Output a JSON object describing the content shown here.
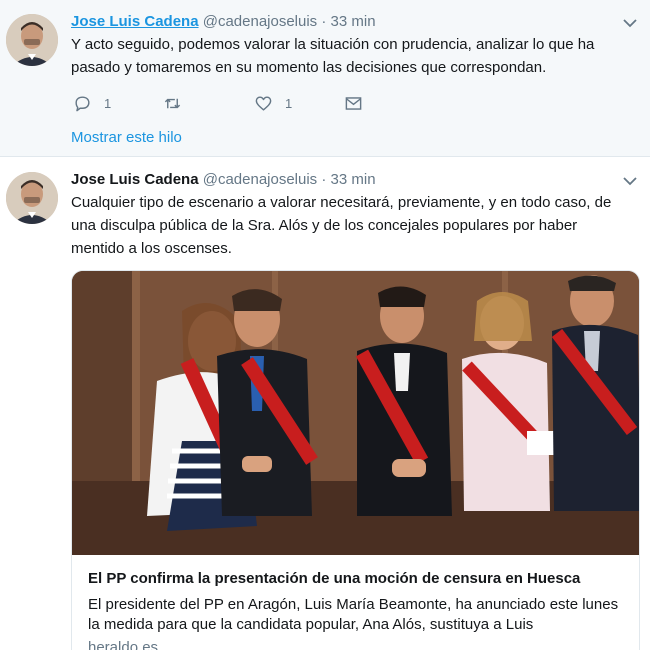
{
  "colors": {
    "link": "#1b95e0",
    "secondary": "#657786",
    "thread_bg": "#f5f8fa"
  },
  "tweets": [
    {
      "name": "Jose Luis Cadena",
      "handle": "@cadenajoseluis",
      "dot": "·",
      "time": "33 min",
      "text": "Y acto seguido,  podemos valorar la situación con prudencia, analizar lo que ha\npasado y tomaremos en su momento las decisiones que correspondan.",
      "actions": {
        "reply_count": "1",
        "retweet_count": "",
        "like_count": "1"
      },
      "show_thread": "Mostrar este hilo"
    },
    {
      "name": "Jose Luis Cadena",
      "handle": "@cadenajoseluis",
      "dot": "·",
      "time": "33 min",
      "text": "Cualquier tipo de escenario a valorar necesitará, previamente, y en todo caso, de\nuna disculpa pública de la Sra. Alós y de los concejales populares por haber\nmentido a los oscenses.",
      "card": {
        "title": "El PP confirma la presentación de una moción de censura en Huesca",
        "description": "El presidente del PP en Aragón, Luis María Beamonte, ha anunciado este lunes la medida para que la  candidata popular, Ana Alós, sustituya a Luis",
        "domain": "heraldo.es"
      }
    }
  ],
  "icons": [
    "chevron-down-icon",
    "reply-icon",
    "retweet-icon",
    "like-icon",
    "direct-message-icon"
  ]
}
